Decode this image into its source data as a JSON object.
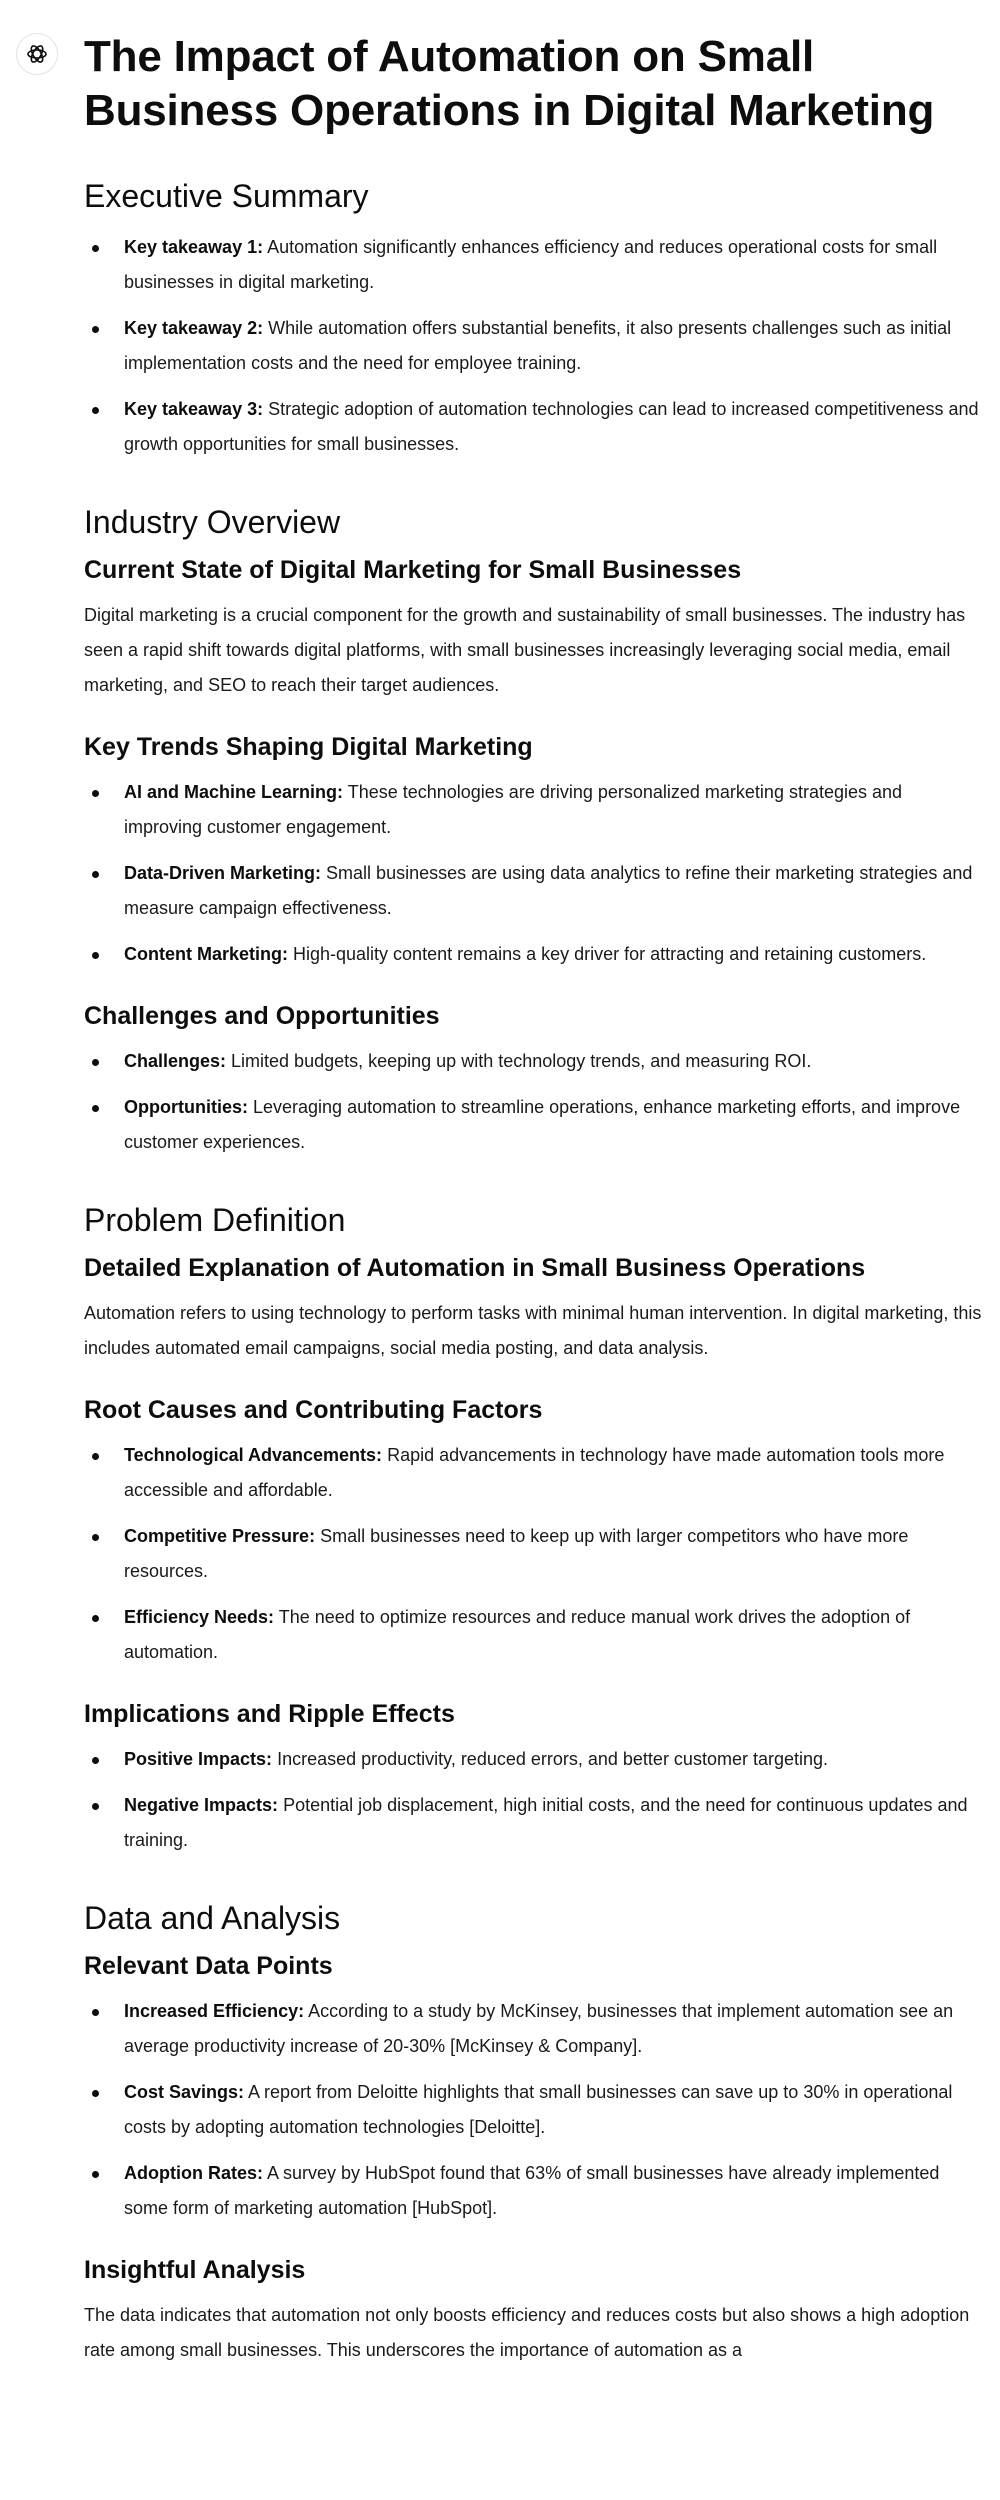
{
  "title": "The Impact of Automation on Small Business Operations in Digital Marketing",
  "executive_summary": {
    "heading": "Executive Summary",
    "items": [
      {
        "label": "Key takeaway 1:",
        "text": " Automation significantly enhances efficiency and reduces operational costs for small businesses in digital marketing."
      },
      {
        "label": "Key takeaway 2:",
        "text": " While automation offers substantial benefits, it also presents challenges such as initial implementation costs and the need for employee training."
      },
      {
        "label": "Key takeaway 3:",
        "text": " Strategic adoption of automation technologies can lead to increased competitiveness and growth opportunities for small businesses."
      }
    ]
  },
  "industry_overview": {
    "heading": "Industry Overview",
    "current_state": {
      "heading": "Current State of Digital Marketing for Small Businesses",
      "text": "Digital marketing is a crucial component for the growth and sustainability of small businesses. The industry has seen a rapid shift towards digital platforms, with small businesses increasingly leveraging social media, email marketing, and SEO to reach their target audiences."
    },
    "key_trends": {
      "heading": "Key Trends Shaping Digital Marketing",
      "items": [
        {
          "label": "AI and Machine Learning:",
          "text": " These technologies are driving personalized marketing strategies and improving customer engagement."
        },
        {
          "label": "Data-Driven Marketing:",
          "text": " Small businesses are using data analytics to refine their marketing strategies and measure campaign effectiveness."
        },
        {
          "label": "Content Marketing:",
          "text": " High-quality content remains a key driver for attracting and retaining customers."
        }
      ]
    },
    "challenges": {
      "heading": "Challenges and Opportunities",
      "items": [
        {
          "label": "Challenges:",
          "text": " Limited budgets, keeping up with technology trends, and measuring ROI."
        },
        {
          "label": "Opportunities:",
          "text": " Leveraging automation to streamline operations, enhance marketing efforts, and improve customer experiences."
        }
      ]
    }
  },
  "problem_definition": {
    "heading": "Problem Definition",
    "explanation": {
      "heading": "Detailed Explanation of Automation in Small Business Operations",
      "text": "Automation refers to using technology to perform tasks with minimal human intervention. In digital marketing, this includes automated email campaigns, social media posting, and data analysis."
    },
    "root_causes": {
      "heading": "Root Causes and Contributing Factors",
      "items": [
        {
          "label": "Technological Advancements:",
          "text": " Rapid advancements in technology have made automation tools more accessible and affordable."
        },
        {
          "label": "Competitive Pressure:",
          "text": " Small businesses need to keep up with larger competitors who have more resources."
        },
        {
          "label": "Efficiency Needs:",
          "text": " The need to optimize resources and reduce manual work drives the adoption of automation."
        }
      ]
    },
    "implications": {
      "heading": "Implications and Ripple Effects",
      "items": [
        {
          "label": "Positive Impacts:",
          "text": " Increased productivity, reduced errors, and better customer targeting."
        },
        {
          "label": "Negative Impacts:",
          "text": " Potential job displacement, high initial costs, and the need for continuous updates and training."
        }
      ]
    }
  },
  "data_analysis": {
    "heading": "Data and Analysis",
    "data_points": {
      "heading": "Relevant Data Points",
      "items": [
        {
          "label": "Increased Efficiency:",
          "text": " According to a study by McKinsey, businesses that implement automation see an average productivity increase of 20-30% [McKinsey & Company]."
        },
        {
          "label": "Cost Savings:",
          "text": " A report from Deloitte highlights that small businesses can save up to 30% in operational costs by adopting automation technologies [Deloitte]."
        },
        {
          "label": "Adoption Rates:",
          "text": " A survey by HubSpot found that 63% of small businesses have already implemented some form of marketing automation [HubSpot]."
        }
      ]
    },
    "insightful_analysis": {
      "heading": "Insightful Analysis",
      "text": "The data indicates that automation not only boosts efficiency and reduces costs but also shows a high adoption rate among small businesses. This underscores the importance of automation as a"
    }
  }
}
